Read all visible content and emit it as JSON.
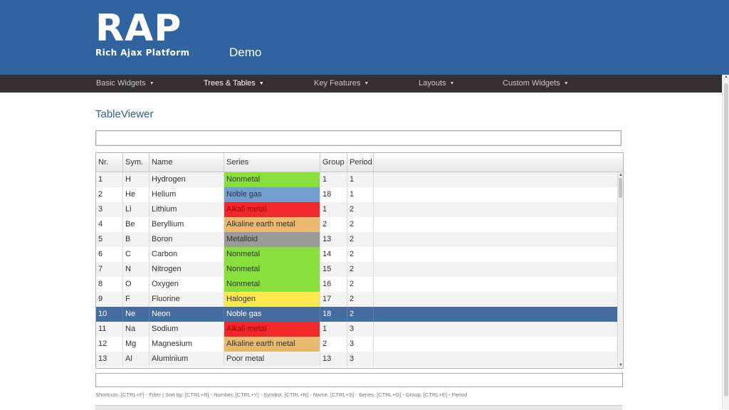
{
  "logo": {
    "big": "RAP",
    "sub": "Rich Ajax Platform"
  },
  "header": {
    "app_title": "Demo"
  },
  "nav": {
    "items": [
      {
        "label": "Basic Widgets"
      },
      {
        "label": "Trees & Tables"
      },
      {
        "label": "Key Features"
      },
      {
        "label": "Layouts"
      },
      {
        "label": "Custom Widgets"
      }
    ],
    "active": "Trees & Tables",
    "caret": "▼"
  },
  "page": {
    "title": "TableViewer"
  },
  "filter": {
    "value": "",
    "placeholder": ""
  },
  "table": {
    "columns": [
      "Nr.",
      "Sym.",
      "Name",
      "Series",
      "Group",
      "Period"
    ],
    "selected_nr": "10",
    "series_colors": {
      "Nonmetal": "#87e13a",
      "Noble gas": "#729fcf",
      "Alkali metal": "#ef2929",
      "Alkaline earth metal": "#e9b96e",
      "Metalloid": "#9a9a9a",
      "Halogen": "#fce94f",
      "Poor metal": "#eeeeec"
    },
    "rows": [
      {
        "nr": "1",
        "sym": "H",
        "name": "Hydrogen",
        "series": "Nonmetal",
        "group": "1",
        "period": "1"
      },
      {
        "nr": "2",
        "sym": "He",
        "name": "Helium",
        "series": "Noble gas",
        "group": "18",
        "period": "1"
      },
      {
        "nr": "3",
        "sym": "Li",
        "name": "Lithium",
        "series": "Alkali metal",
        "group": "1",
        "period": "2"
      },
      {
        "nr": "4",
        "sym": "Be",
        "name": "Beryllium",
        "series": "Alkaline earth metal",
        "group": "2",
        "period": "2"
      },
      {
        "nr": "5",
        "sym": "B",
        "name": "Boron",
        "series": "Metalloid",
        "group": "13",
        "period": "2"
      },
      {
        "nr": "6",
        "sym": "C",
        "name": "Carbon",
        "series": "Nonmetal",
        "group": "14",
        "period": "2"
      },
      {
        "nr": "7",
        "sym": "N",
        "name": "Nitrogen",
        "series": "Nonmetal",
        "group": "15",
        "period": "2"
      },
      {
        "nr": "8",
        "sym": "O",
        "name": "Oxygen",
        "series": "Nonmetal",
        "group": "16",
        "period": "2"
      },
      {
        "nr": "9",
        "sym": "F",
        "name": "Fluorine",
        "series": "Halogen",
        "group": "17",
        "period": "2"
      },
      {
        "nr": "10",
        "sym": "Ne",
        "name": "Neon",
        "series": "Noble gas",
        "group": "18",
        "period": "2"
      },
      {
        "nr": "11",
        "sym": "Na",
        "name": "Sodium",
        "series": "Alkali metal",
        "group": "1",
        "period": "3"
      },
      {
        "nr": "12",
        "sym": "Mg",
        "name": "Magnesium",
        "series": "Alkaline earth metal",
        "group": "2",
        "period": "3"
      },
      {
        "nr": "13",
        "sym": "Al",
        "name": "Aluminium",
        "series": "Poor metal",
        "group": "13",
        "period": "3"
      }
    ]
  },
  "shortcuts": "Shortcuts: [CTRL+F] - Filter | Sort by: [CTRL+R] - Number, [CTRL+Y] - Symbol, [CTRL+N] - Name, [CTRL+S] - Series, [CTRL+G] - Group, [CTRL+E] - Period",
  "icons": {
    "scroll_up": "▲",
    "scroll_down": "▼"
  }
}
